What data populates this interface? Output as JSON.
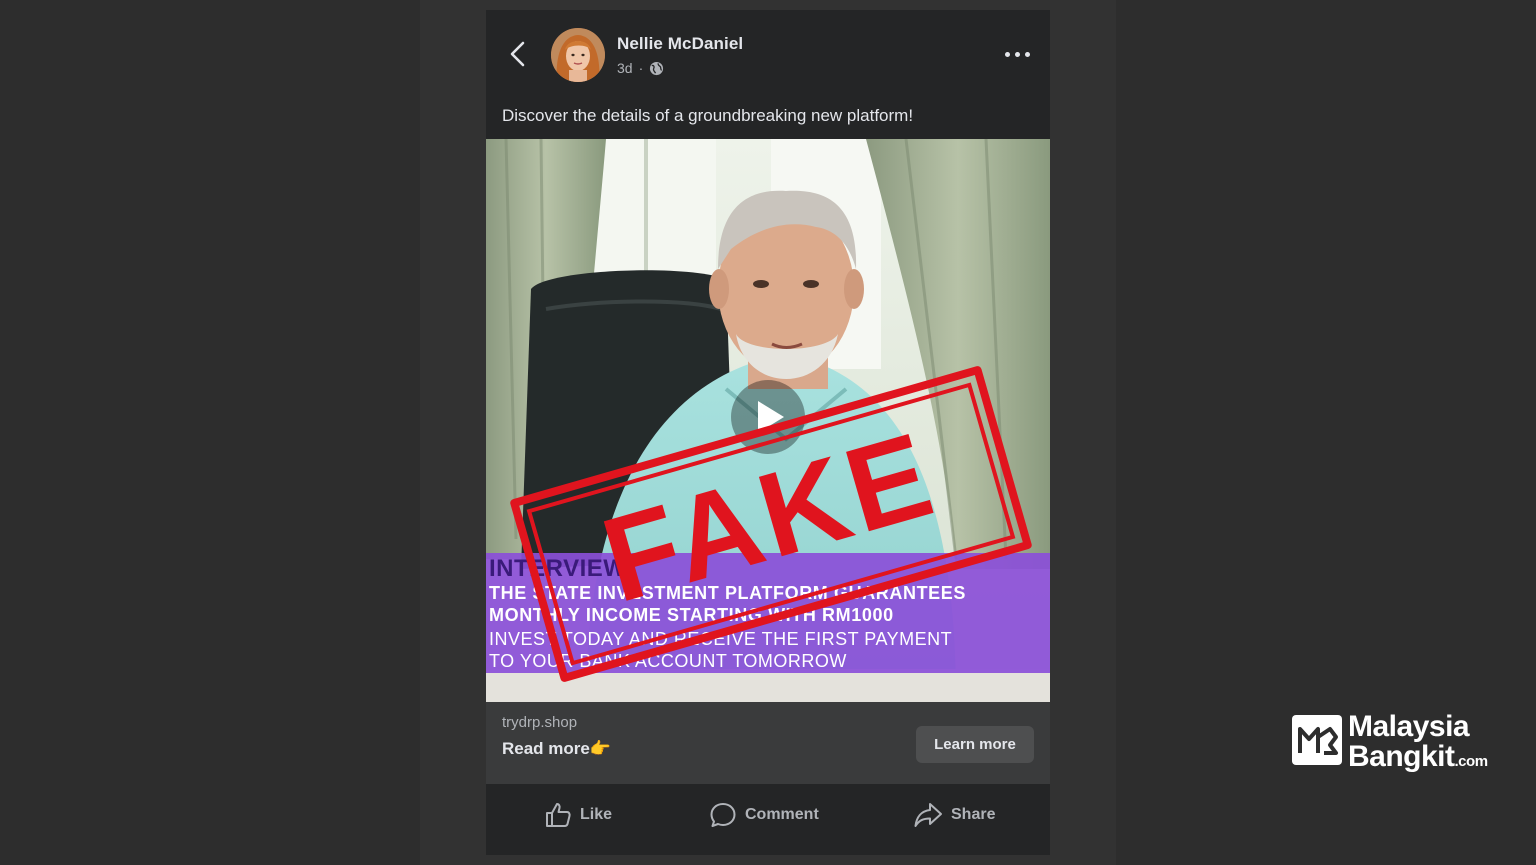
{
  "post": {
    "author_name": "Nellie McDaniel",
    "time": "3d",
    "separator": "·",
    "caption": "Discover the details of a groundbreaking new platform!",
    "video": {
      "banner_heading": "INTERVIEW",
      "banner_line1": "THE STATE INVESTMENT PLATFORM GUARANTEES",
      "banner_line2": "MONTHLY INCOME STARTING WITH RM1000",
      "banner_line3": "INVEST TODAY AND RECEIVE THE FIRST PAYMENT",
      "banner_line4": "TO YOUR BANK ACCOUNT TOMORROW",
      "stamp_text": "FAKE"
    },
    "link": {
      "domain": "trydrp.shop",
      "title": "Read more👉",
      "cta_label": "Learn more"
    },
    "actions": {
      "like_label": "Like",
      "comment_label": "Comment",
      "share_label": "Share"
    }
  },
  "watermark": {
    "line1": "Malaysia",
    "line2": "Bangkit",
    "suffix": ".com"
  },
  "icons": {
    "back": "chevron-left-icon",
    "more": "more-horizontal-icon",
    "globe": "globe-icon",
    "play": "play-icon",
    "like": "thumbs-up-icon",
    "comment": "comment-bubble-icon",
    "share": "share-arrow-icon"
  },
  "colors": {
    "page_background": "#2d2d2d",
    "card_background": "#242526",
    "link_area": "#3a3b3c",
    "banner_purple": "#8b4fd8",
    "stamp_red": "#e0141e",
    "text_primary": "#e4e6eb",
    "text_secondary": "#b0b3b8"
  }
}
